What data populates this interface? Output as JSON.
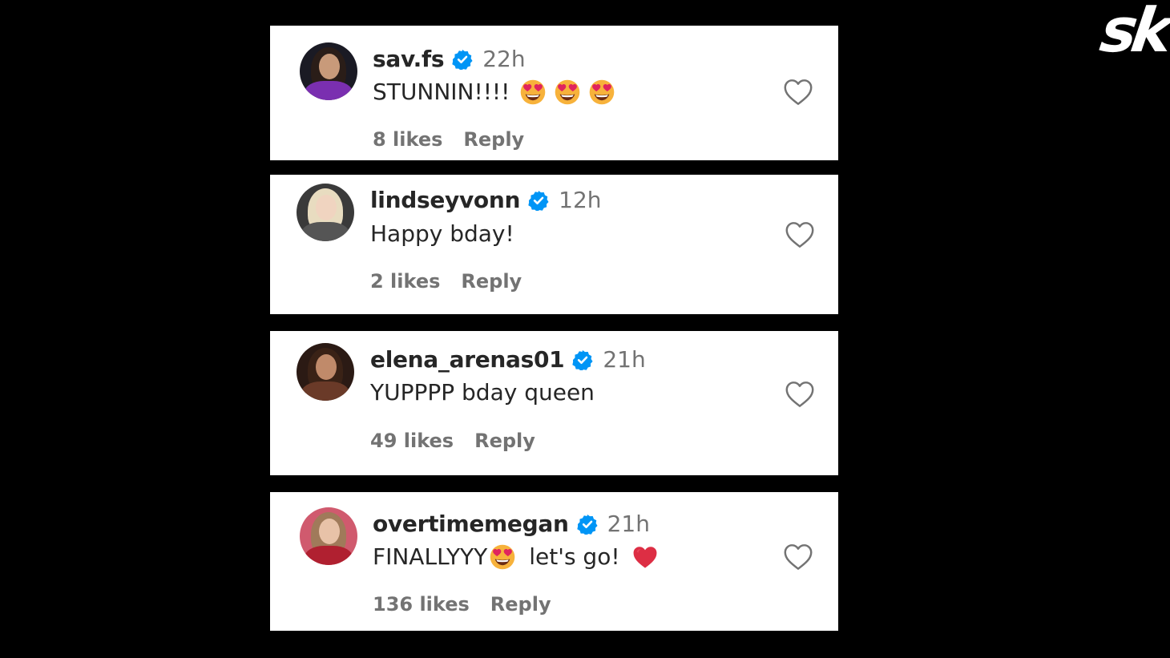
{
  "brand": {
    "logo_text": "sk"
  },
  "comments": [
    {
      "username": "sav.fs",
      "verified": true,
      "time": "22h",
      "text": "STUNNIN!!!!",
      "emojis": [
        "heart-eyes-emoji",
        "heart-eyes-emoji",
        "heart-eyes-emoji"
      ],
      "likes": "8 likes",
      "reply": "Reply"
    },
    {
      "username": "lindseyvonn",
      "verified": true,
      "time": "12h",
      "text": "Happy bday!",
      "likes": "2 likes",
      "reply": "Reply"
    },
    {
      "username": "elena_arenas01",
      "verified": true,
      "time": "21h",
      "text": "YUPPPP bday queen",
      "likes": "49 likes",
      "reply": "Reply"
    },
    {
      "username": "overtimemegan",
      "verified": true,
      "time": "21h",
      "text_before": "FINALLYYY",
      "text_after": "let's go!",
      "emojis": [
        "heart-eyes-emoji",
        "red-heart-emoji"
      ],
      "likes": "136 likes",
      "reply": "Reply"
    }
  ],
  "colors": {
    "background": "#000000",
    "card": "#ffffff",
    "text_primary": "#262626",
    "text_secondary": "#737373",
    "verified_badge": "#0095f6",
    "heart_outline": "#737373"
  }
}
